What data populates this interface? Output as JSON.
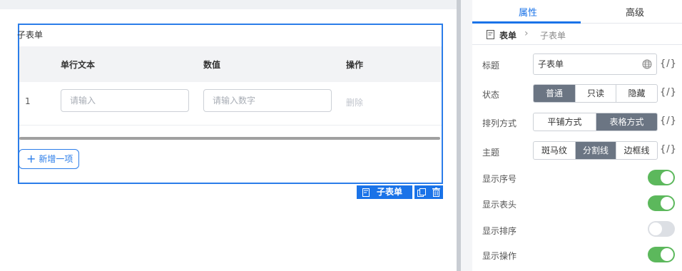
{
  "canvas": {
    "subform_title": "子表单",
    "columns": [
      "单行文本",
      "数值",
      "操作"
    ],
    "row_number": "1",
    "text_placeholder": "请输入",
    "number_placeholder": "请输入数字",
    "delete_label": "删除",
    "add_label": "新增一项",
    "tag_label": "子表单"
  },
  "panel": {
    "tabs": [
      "属性",
      "高级"
    ],
    "breadcrumb": [
      "表单",
      "子表单"
    ],
    "title_label": "标题",
    "title_value": "子表单",
    "fx_label": "{/}",
    "status_label": "状态",
    "status_options": [
      "普通",
      "只读",
      "隐藏"
    ],
    "layout_label": "排列方式",
    "layout_options": [
      "平铺方式",
      "表格方式"
    ],
    "theme_label": "主题",
    "theme_options": [
      "斑马纹",
      "分割线",
      "边框线"
    ],
    "toggles": [
      {
        "label": "显示序号",
        "on": true
      },
      {
        "label": "显示表头",
        "on": true
      },
      {
        "label": "显示排序",
        "on": false
      },
      {
        "label": "显示操作",
        "on": true
      }
    ]
  },
  "colors": {
    "accent": "#1a73e8",
    "toggle_on": "#5cb85c",
    "segment_active": "#6b7583"
  }
}
